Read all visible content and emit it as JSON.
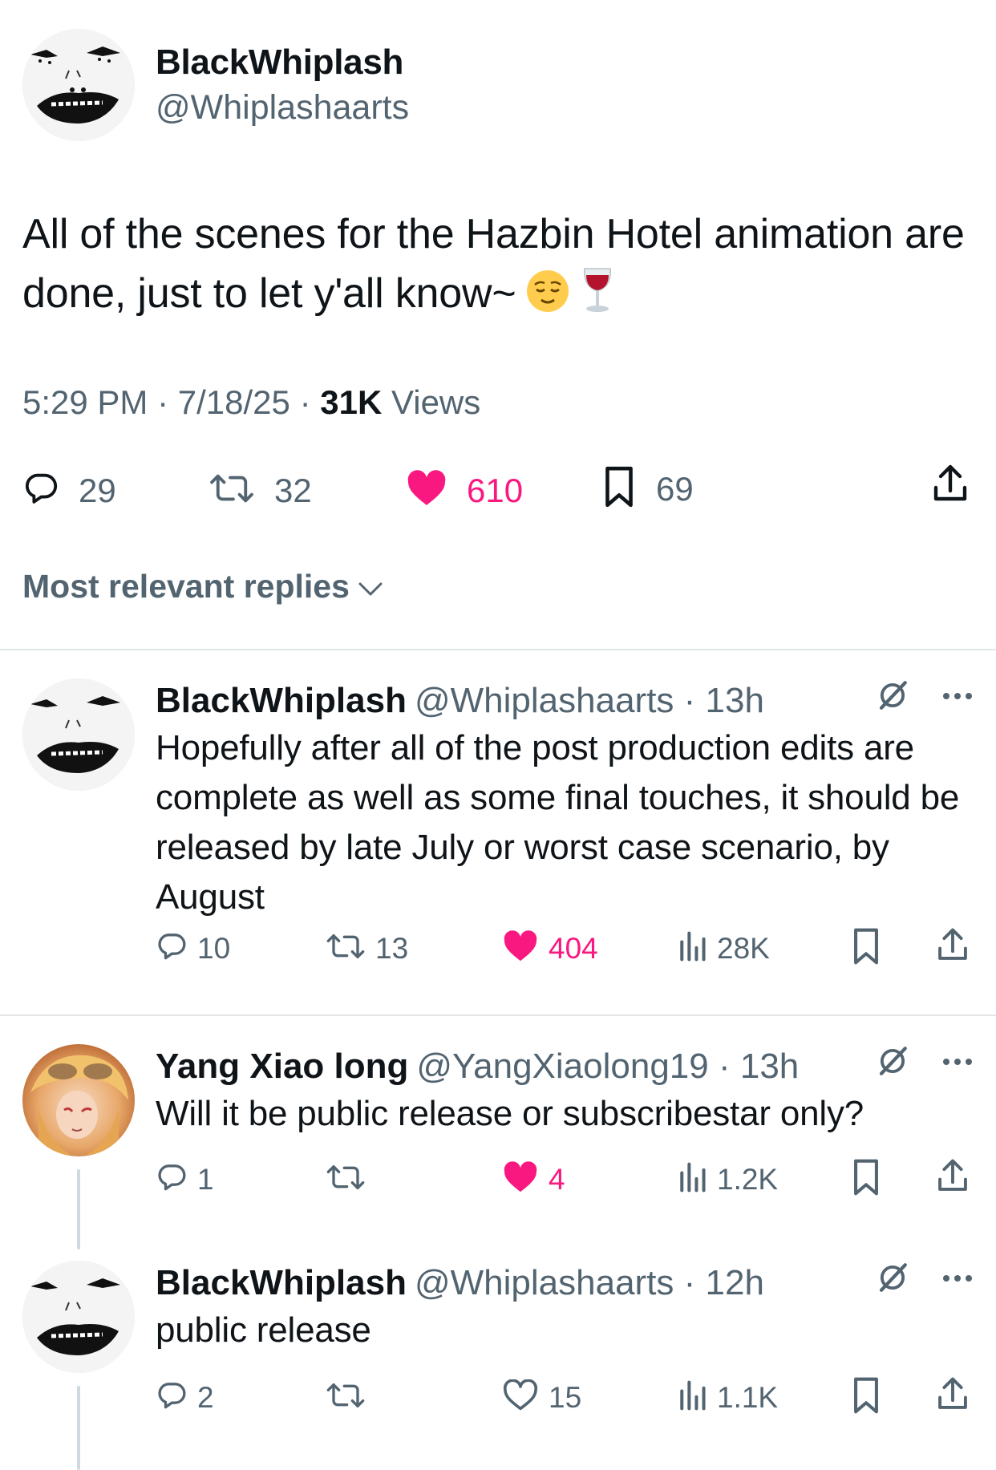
{
  "main_tweet": {
    "author_name": "BlackWhiplash",
    "author_handle": "@Whiplashaarts",
    "text": "All of the scenes for the Hazbin Hotel animation are done, just to let y'all know~",
    "emojis": [
      "relieved-face-emoji",
      "wine-glass-emoji"
    ],
    "time": "5:29 PM",
    "date": "7/18/25",
    "views_count": "31K",
    "views_label": "Views",
    "separator": "·",
    "replies": "29",
    "reposts": "32",
    "likes": "610",
    "bookmarks": "69"
  },
  "sort_label": "Most relevant replies",
  "replies": [
    {
      "name": "BlackWhiplash",
      "handle": "@Whiplashaarts",
      "time": "· 13h",
      "text": "Hopefully after all of the post production edits are complete as well as some final touches, it should be released by late July or worst case scenario, by August",
      "replies": "10",
      "reposts": "13",
      "likes": "404",
      "liked": true,
      "views": "28K"
    },
    {
      "name": "Yang Xiao long",
      "handle": "@YangXiaolong19",
      "time": "· 13h",
      "text": "Will it be public release or subscribestar only?",
      "replies": "1",
      "reposts": "",
      "likes": "4",
      "liked": true,
      "views": "1.2K"
    },
    {
      "name": "BlackWhiplash",
      "handle": "@Whiplashaarts",
      "time": "· 12h",
      "text": "public release",
      "replies": "2",
      "reposts": "",
      "likes": "15",
      "liked": false,
      "views": "1.1K"
    }
  ],
  "colors": {
    "like_active": "#f91880",
    "secondary_text": "#536471",
    "primary_text": "#0f1419",
    "divider": "#e3e6e8"
  }
}
